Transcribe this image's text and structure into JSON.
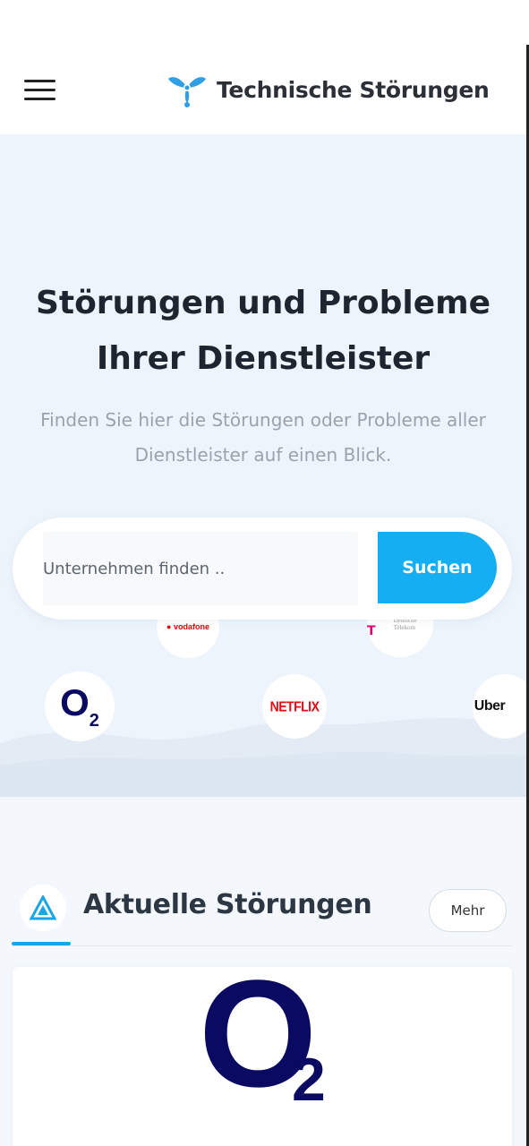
{
  "header": {
    "brand_name": "Technische Störungen",
    "menu_icon": "hamburger-menu-icon",
    "logo_icon": "propeller-logo-icon"
  },
  "hero": {
    "title_line1": "Störungen und Probleme",
    "title_line2": "Ihrer Dienstleister",
    "subtitle_line1": "Finden Sie hier die Störungen oder Probleme aller",
    "subtitle_line2": "Dienstleister auf einen Blick."
  },
  "search": {
    "placeholder": "Unternehmen finden ..",
    "button_label": "Suchen"
  },
  "providers": {
    "vodafone": "vodafone",
    "telekom": "Deutsche Telekom",
    "o2_main": "O",
    "o2_sub": "2",
    "netflix": "NETFLIX",
    "uber": "Uber"
  },
  "section": {
    "title": "Aktuelle Störungen",
    "more_label": "Mehr",
    "icon": "triangle-alert-icon"
  },
  "card": {
    "logo_main": "O",
    "logo_sub": "2"
  },
  "colors": {
    "accent": "#16aef2",
    "hero_bg": "#edf4fb",
    "o2_blue": "#0b0a63",
    "netflix_red": "#e50914",
    "vodafone_red": "#e60000",
    "telekom_magenta": "#e20074"
  }
}
